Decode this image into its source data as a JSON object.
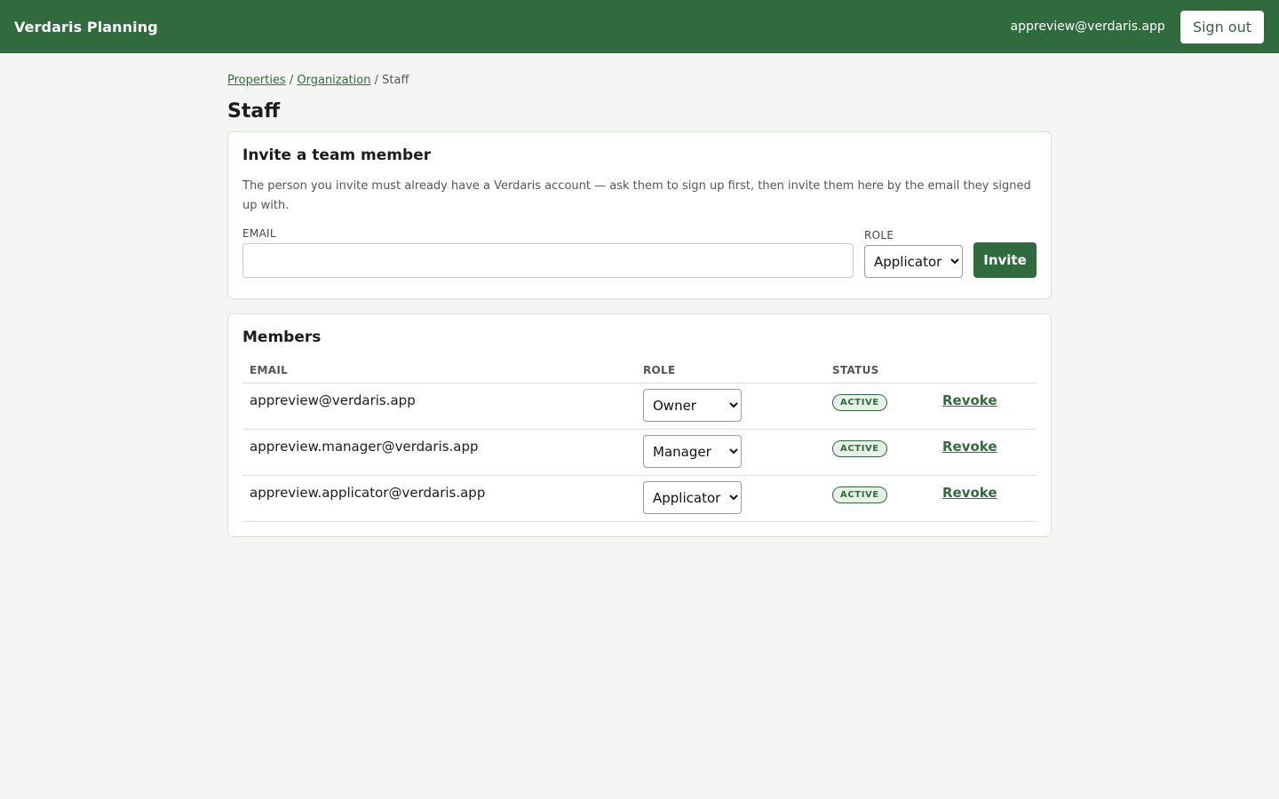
{
  "header": {
    "brand": "Verdaris Planning",
    "user_email": "appreview@verdaris.app",
    "signout_label": "Sign out"
  },
  "breadcrumb": {
    "items": [
      "Properties",
      "Organization",
      "Staff"
    ],
    "separator": "/"
  },
  "page": {
    "title": "Staff"
  },
  "invite": {
    "title": "Invite a team member",
    "help": "The person you invite must already have a Verdaris account — ask them to sign up first, then invite them here by the email they signed up with.",
    "email_label": "EMAIL",
    "email_value": "",
    "email_placeholder": "",
    "role_label": "ROLE",
    "role_selected": "Applicator",
    "button_label": "Invite"
  },
  "members": {
    "title": "Members",
    "columns": [
      "EMAIL",
      "ROLE",
      "STATUS",
      ""
    ],
    "rows": [
      {
        "email": "appreview@verdaris.app",
        "role": "Owner",
        "status": "ACTIVE",
        "action": "Revoke"
      },
      {
        "email": "appreview.manager@verdaris.app",
        "role": "Manager",
        "status": "ACTIVE",
        "action": "Revoke"
      },
      {
        "email": "appreview.applicator@verdaris.app",
        "role": "Applicator",
        "status": "ACTIVE",
        "action": "Revoke"
      }
    ]
  },
  "colors": {
    "brand_green": "#2f6b3d",
    "page_background": "#f4f6f3",
    "badge_background": "#e6f1e7"
  }
}
